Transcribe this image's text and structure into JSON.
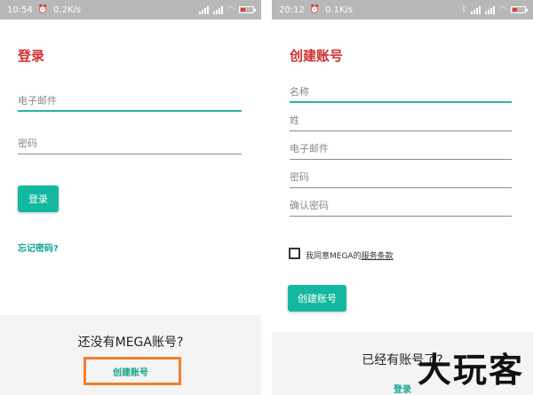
{
  "left_screen": {
    "statusbar": {
      "time": "10:54",
      "speed": "0.2K/s"
    },
    "title": "登录",
    "email_placeholder": "电子邮件",
    "password_placeholder": "密码",
    "login_button": "登录",
    "forgot_password": "忘记密码?",
    "footer_prompt": "还没有MEGA账号?",
    "create_account_link": "创建账号"
  },
  "right_screen": {
    "statusbar": {
      "time": "20:12",
      "speed": "0.1K/s"
    },
    "title": "创建账号",
    "name_placeholder": "名称",
    "surname_placeholder": "姓",
    "email_placeholder": "电子邮件",
    "password_placeholder": "密码",
    "confirm_password_placeholder": "确认密码",
    "terms_prefix": "我同意MEGA的",
    "terms_link": "服务条款",
    "create_button": "创建账号",
    "footer_prompt": "已经有账号了?",
    "login_link": "登录"
  },
  "watermark": "大玩客",
  "colors": {
    "accent": "#14b8a0",
    "title": "#d32f2f",
    "highlight": "#f07f2e",
    "statusbar": "#b8b8b8"
  },
  "icons": [
    "alarm-icon",
    "signal-icon",
    "wifi-icon",
    "battery-icon",
    "bluetooth-icon"
  ]
}
